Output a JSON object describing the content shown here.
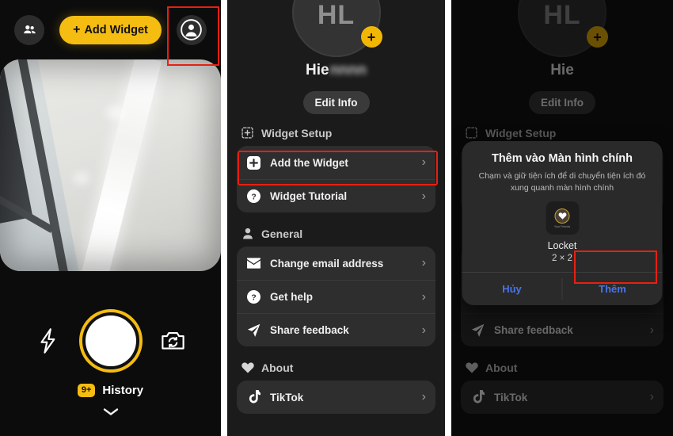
{
  "panels": {
    "camera": {
      "name": "Locket camera screen",
      "topbar": {
        "friends_icon": "people-icon",
        "add_widget_label": "Add Widget",
        "add_widget_plus": "+",
        "profile_icon": "person-circle-icon"
      },
      "controls": {
        "flash_icon": "flash-bolt-icon",
        "shutter_icon": "shutter-button",
        "flip_icon": "camera-flip-icon"
      },
      "history": {
        "badge": "9+",
        "label": "History",
        "chevron": "chevron-down-icon"
      },
      "accent_color": "#F5BC12"
    },
    "settings": {
      "name": "Locket profile settings sheet",
      "avatar_initials": "HL",
      "avatar_plus": "+",
      "username": "Hie",
      "username_blurred": "nnnn",
      "edit_info_label": "Edit Info",
      "sections": [
        {
          "icon": "widget-add-icon",
          "title": "Widget Setup",
          "rows": [
            {
              "icon": "plus-square-icon",
              "label": "Add the Widget",
              "chevron": "›"
            },
            {
              "icon": "question-circle-icon",
              "label": "Widget Tutorial",
              "chevron": "›"
            }
          ]
        },
        {
          "icon": "person-icon",
          "title": "General",
          "rows": [
            {
              "icon": "envelope-icon",
              "label": "Change email address",
              "chevron": "›"
            },
            {
              "icon": "question-circle-icon",
              "label": "Get help",
              "chevron": "›"
            },
            {
              "icon": "paper-plane-icon",
              "label": "Share feedback",
              "chevron": "›"
            }
          ]
        },
        {
          "icon": "heart-icon",
          "title": "About",
          "rows": [
            {
              "icon": "tiktok-icon",
              "label": "TikTok",
              "chevron": "›"
            }
          ]
        }
      ]
    },
    "dialog_screen": {
      "name": "Add to Home Screen system dialog",
      "dialog": {
        "title": "Thêm vào Màn hình chính",
        "subtitle": "Chạm và giữ tiện ích để di chuyển tiện ích đó xung quanh màn hình chính",
        "widget_preview_icon": "locket-heart-widget-icon",
        "widget_preview_caption": "Your Friends",
        "widget_name": "Locket",
        "widget_size": "2 × 2",
        "cancel_label": "Hủy",
        "confirm_label": "Thêm",
        "button_color": "#4a74e8"
      }
    }
  },
  "highlights": [
    {
      "name": "profile-button-highlight",
      "color": "#e81f12"
    },
    {
      "name": "add-the-widget-highlight",
      "color": "#e81f12"
    },
    {
      "name": "confirm-them-highlight",
      "color": "#e81f12"
    }
  ]
}
